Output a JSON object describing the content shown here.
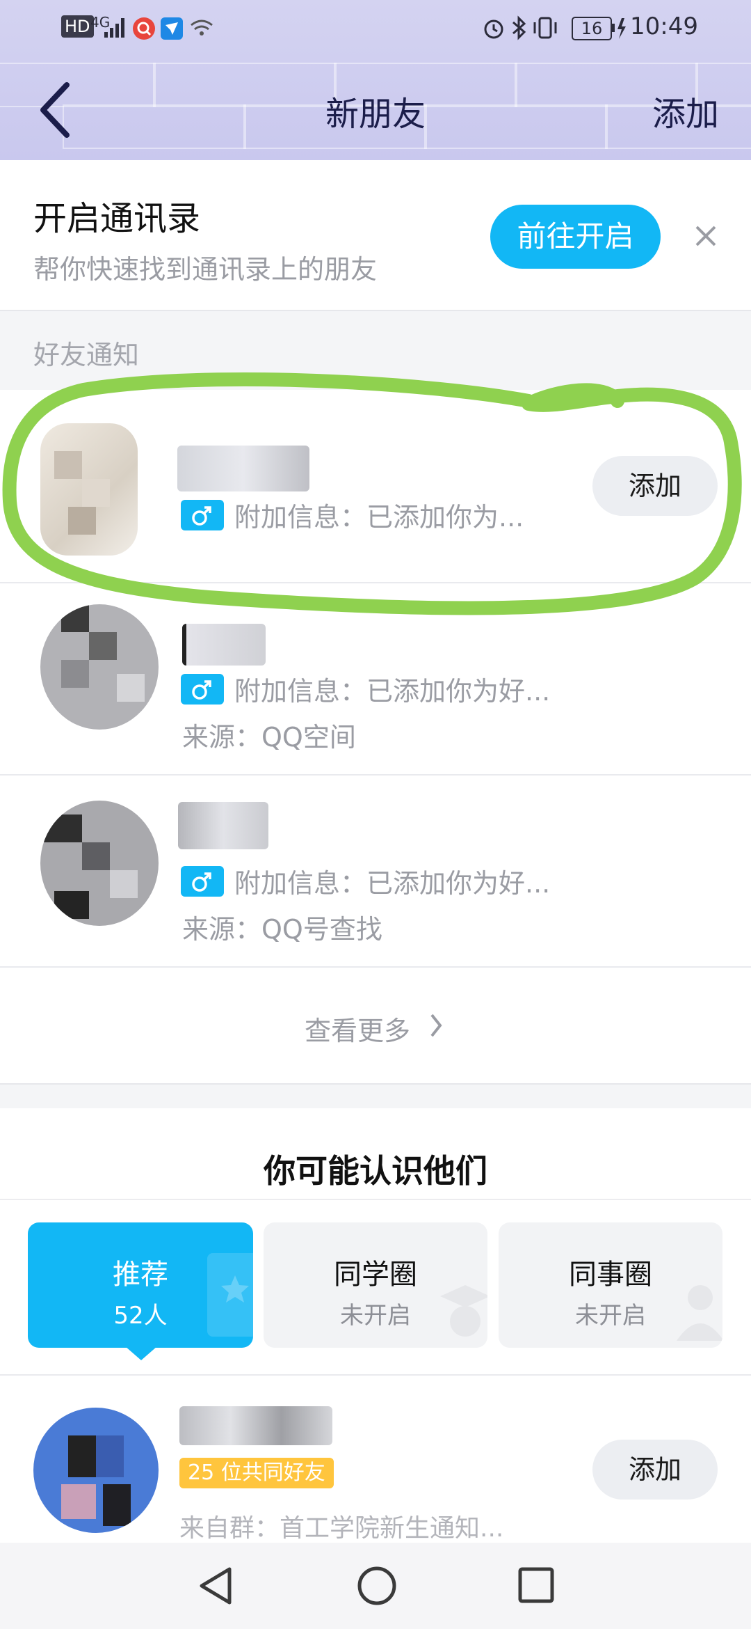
{
  "status": {
    "network": "4G",
    "battery": "16",
    "time": "10:49",
    "hd": "HD"
  },
  "nav": {
    "back": "back",
    "title": "新朋友",
    "add": "添加"
  },
  "contacts_banner": {
    "title": "开启通讯录",
    "subtitle": "帮你快速找到通讯录上的朋友",
    "button": "前往开启",
    "close_icon": "close-icon"
  },
  "notifications": {
    "header": "好友通知",
    "items": [
      {
        "info": "附加信息：已添加你为...",
        "source": "",
        "button": "添加"
      },
      {
        "info": "附加信息：已添加你为好...",
        "source": "来源：QQ空间"
      },
      {
        "info": "附加信息：已添加你为好...",
        "source": "来源：QQ号查找"
      }
    ],
    "more": "查看更多"
  },
  "suggest": {
    "title": "你可能认识他们",
    "tabs": [
      {
        "label": "推荐",
        "sub": "52人"
      },
      {
        "label": "同学圈",
        "sub": "未开启"
      },
      {
        "label": "同事圈",
        "sub": "未开启"
      }
    ],
    "person": {
      "mutual": "25 位共同好友",
      "source": "来自群：首工学院新生通知...",
      "button": "添加"
    }
  },
  "colors": {
    "accent": "#12b7f5",
    "highlight": "#8fd14f",
    "mutual_tag": "#ffc53d"
  }
}
